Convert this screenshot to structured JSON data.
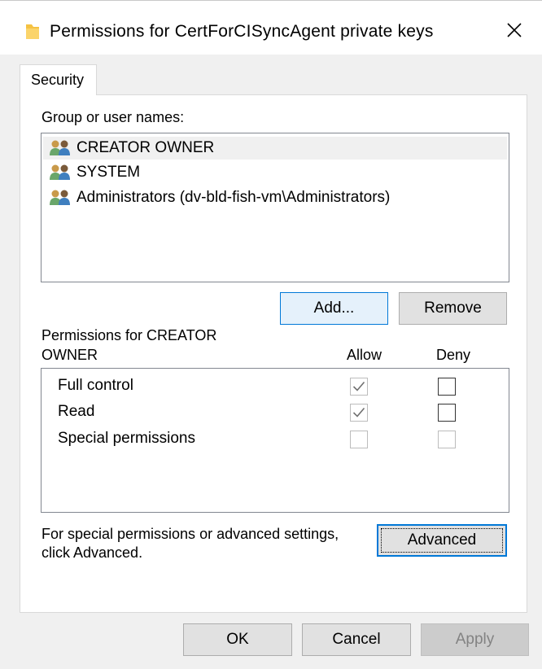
{
  "window": {
    "title": "Permissions for CertForCISyncAgent private keys",
    "close_label": "✕"
  },
  "tabs": [
    {
      "label": "Security",
      "active": true
    }
  ],
  "group_section": {
    "label": "Group or user names:",
    "users": [
      {
        "name": "CREATOR OWNER",
        "selected": true
      },
      {
        "name": "SYSTEM",
        "selected": false
      },
      {
        "name": "Administrators (dv-bld-fish-vm\\Administrators)",
        "selected": false
      }
    ],
    "add_label": "Add...",
    "remove_label": "Remove"
  },
  "permissions": {
    "label_line1": "Permissions for CREATOR",
    "label_line2": "OWNER",
    "allow_header": "Allow",
    "deny_header": "Deny",
    "rows": [
      {
        "name": "Full control",
        "allow": "checked-disabled",
        "deny": "unchecked"
      },
      {
        "name": "Read",
        "allow": "checked-disabled",
        "deny": "unchecked"
      },
      {
        "name": "Special permissions",
        "allow": "disabled",
        "deny": "disabled"
      }
    ]
  },
  "advanced": {
    "text_line1": "For special permissions or advanced settings,",
    "text_line2": "click Advanced.",
    "button_label": "Advanced"
  },
  "footer": {
    "ok_label": "OK",
    "cancel_label": "Cancel",
    "apply_label": "Apply"
  },
  "colors": {
    "accent": "#0078d7",
    "folder": "#f5c242",
    "dialog_bg": "#f0f0f0"
  },
  "icons": {
    "title": "folder-icon",
    "close": "close-icon",
    "user": "users-group-icon",
    "check": "checkmark-icon"
  }
}
